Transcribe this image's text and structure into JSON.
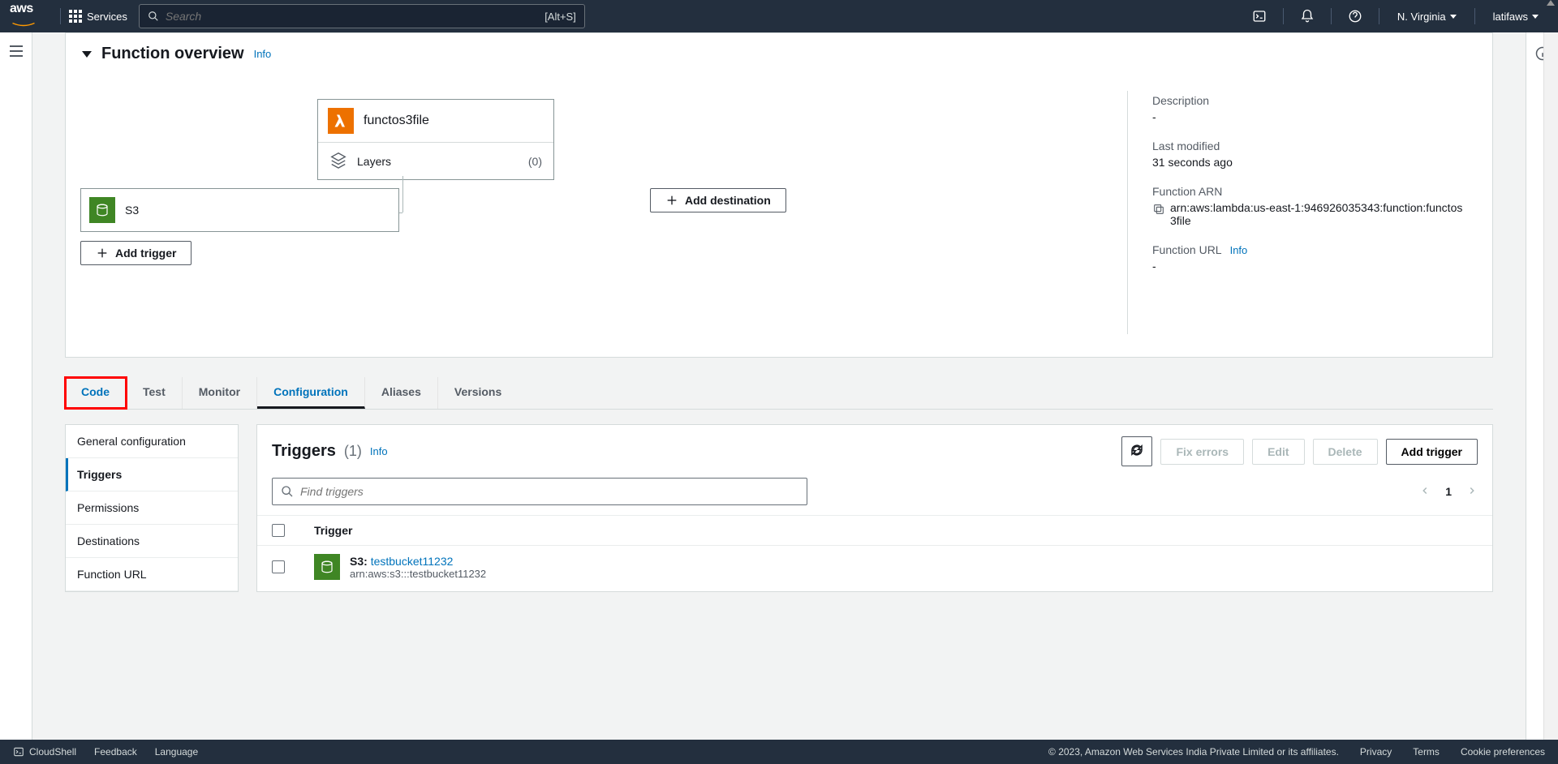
{
  "nav": {
    "services": "Services",
    "search_placeholder": "Search",
    "search_shortcut": "[Alt+S]",
    "region": "N. Virginia",
    "account": "latifaws"
  },
  "overview": {
    "title": "Function overview",
    "info": "Info",
    "function_name": "functos3file",
    "layers_label": "Layers",
    "layers_count": "(0)",
    "trigger_source": "S3",
    "add_trigger": "Add trigger",
    "add_destination": "Add destination"
  },
  "meta": {
    "description_label": "Description",
    "description_value": "-",
    "modified_label": "Last modified",
    "modified_value": "31 seconds ago",
    "arn_label": "Function ARN",
    "arn_value": "arn:aws:lambda:us-east-1:946926035343:function:functos3file",
    "url_label": "Function URL",
    "url_info": "Info",
    "url_value": "-"
  },
  "tabs": {
    "code": "Code",
    "test": "Test",
    "monitor": "Monitor",
    "configuration": "Configuration",
    "aliases": "Aliases",
    "versions": "Versions"
  },
  "sidenav": {
    "general": "General configuration",
    "triggers": "Triggers",
    "permissions": "Permissions",
    "destinations": "Destinations",
    "function_url": "Function URL"
  },
  "triggers_panel": {
    "title": "Triggers",
    "count": "(1)",
    "info": "Info",
    "fix_errors": "Fix errors",
    "edit": "Edit",
    "delete": "Delete",
    "add_trigger": "Add trigger",
    "find_placeholder": "Find triggers",
    "page": "1",
    "th_trigger": "Trigger",
    "row": {
      "service": "S3",
      "sep": ": ",
      "name": "testbucket11232",
      "arn": "arn:aws:s3:::testbucket11232"
    }
  },
  "footer": {
    "cloudshell": "CloudShell",
    "feedback": "Feedback",
    "language": "Language",
    "copyright": "© 2023, Amazon Web Services India Private Limited or its affiliates.",
    "privacy": "Privacy",
    "terms": "Terms",
    "cookie": "Cookie preferences"
  }
}
